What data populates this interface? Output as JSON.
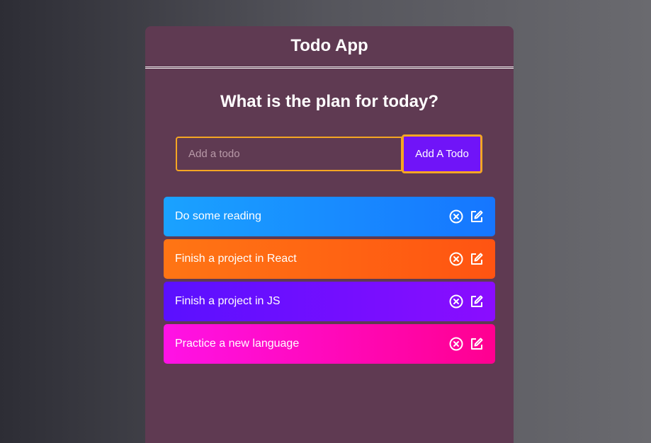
{
  "header": {
    "title": "Todo App"
  },
  "main": {
    "heading": "What is the plan for today?",
    "input": {
      "value": "",
      "placeholder": "Add a todo"
    },
    "add_button_label": "Add A Todo"
  },
  "todos": [
    {
      "text": "Do some reading",
      "color": "#1a8cff",
      "delete_icon": "close-circle-icon",
      "edit_icon": "edit-icon"
    },
    {
      "text": "Finish a project in React",
      "color": "#ff6513",
      "delete_icon": "close-circle-icon",
      "edit_icon": "edit-icon"
    },
    {
      "text": "Finish a project in JS",
      "color": "#750eff",
      "delete_icon": "close-circle-icon",
      "edit_icon": "edit-icon"
    },
    {
      "text": "Practice a new language",
      "color": "#ff09bb",
      "delete_icon": "close-circle-icon",
      "edit_icon": "edit-icon"
    }
  ],
  "colors": {
    "panel": "#5f3a52",
    "accent_border": "#f5a623",
    "button": "#7014f8"
  }
}
